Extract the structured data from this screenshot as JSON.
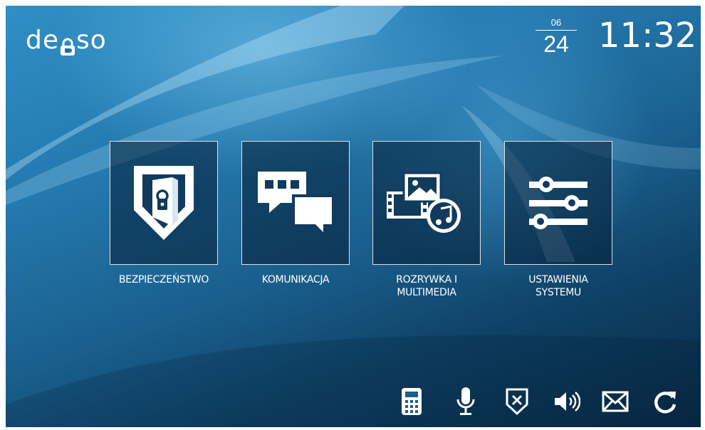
{
  "logo": {
    "text_before": "de",
    "text_after": "so",
    "lettering": "derso"
  },
  "clock": {
    "month": "06",
    "day": "24",
    "time": "11:32"
  },
  "tiles": [
    {
      "label": "BEZPIECZEŃSTWO",
      "icon": "security-shield-lock-icon"
    },
    {
      "label": "KOMUNIKACJA",
      "icon": "chat-bubbles-icon"
    },
    {
      "label": "ROZRYWKA I\nMULTIMEDIA",
      "icon": "multimedia-icon"
    },
    {
      "label": "USTAWIENIA\nSYSTEMU",
      "icon": "sliders-settings-icon"
    }
  ],
  "toolbar": {
    "icons": [
      "intercom-phone-icon",
      "microphone-icon",
      "alarm-shield-x-icon",
      "speaker-volume-icon",
      "mail-envelope-icon",
      "refresh-icon"
    ]
  },
  "colors": {
    "accent_text": "#ffffff",
    "background_top": "#2f8fc6",
    "background_bottom": "#082a45",
    "tile_fill": "#0b2b47"
  }
}
